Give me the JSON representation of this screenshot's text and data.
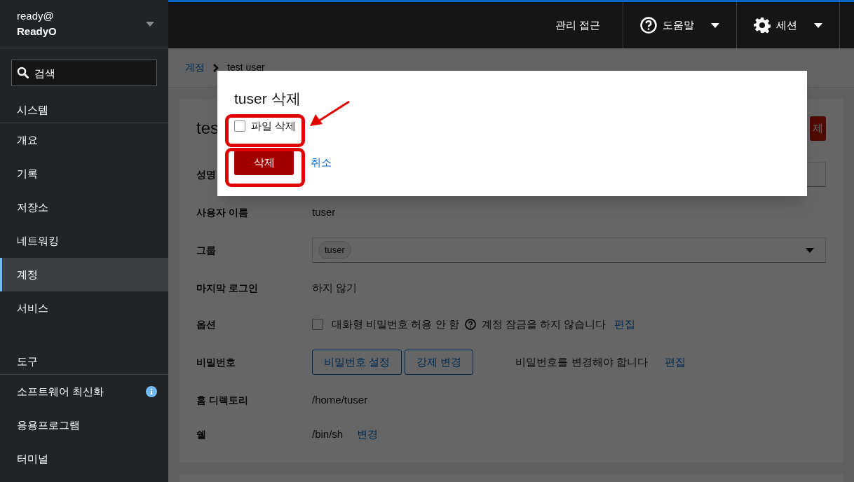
{
  "sidebar": {
    "host": {
      "user": "ready@",
      "name": "ReadyO"
    },
    "search": {
      "placeholder": "검색"
    },
    "sections": [
      {
        "title": "시스템",
        "items": [
          {
            "label": "개요",
            "selected": false
          },
          {
            "label": "기록",
            "selected": false
          },
          {
            "label": "저장소",
            "selected": false
          },
          {
            "label": "네트워킹",
            "selected": false
          },
          {
            "label": "계정",
            "selected": true
          },
          {
            "label": "서비스",
            "selected": false
          }
        ]
      },
      {
        "title": "도구",
        "items": [
          {
            "label": "소프트웨어 최신화",
            "selected": false,
            "info": true
          },
          {
            "label": "응용프로그램",
            "selected": false
          },
          {
            "label": "터미널",
            "selected": false
          }
        ]
      }
    ]
  },
  "topbar": {
    "admin": "관리 접근",
    "help": "도움말",
    "session": "세션"
  },
  "breadcrumb": {
    "parent": "계정",
    "current": "test user"
  },
  "account": {
    "title": "tes",
    "delete_button": "제",
    "rows": [
      {
        "kind": "field",
        "label": "성명"
      },
      {
        "kind": "text",
        "label": "사용자 이름",
        "value": "tuser"
      },
      {
        "kind": "select",
        "label": "그룹",
        "chip": "tuser"
      },
      {
        "kind": "text",
        "label": "마지막 로그인",
        "value": "하지 않기"
      },
      {
        "kind": "options",
        "label": "옵션",
        "checkbox": "대화형 비밀번호 허용 안 함",
        "checked": false,
        "note": "계정 잠금을 하지 않습니다",
        "link": "편집"
      },
      {
        "kind": "password",
        "label": "비밀번호",
        "buttons": [
          "비밀번호 설정",
          "강제 변경"
        ],
        "note": "비밀번호를 변경해야 합니다",
        "link": "편집"
      },
      {
        "kind": "text",
        "label": "홈 디렉토리",
        "value": "/home/tuser"
      },
      {
        "kind": "shell",
        "label": "쉘",
        "value": "/bin/sh",
        "link": "변경"
      }
    ]
  },
  "dialog": {
    "title": "tuser 삭제",
    "checkbox": {
      "label": "파일 삭제",
      "checked": false,
      "highlight": true,
      "arrow": true
    },
    "confirm": {
      "label": "삭제",
      "highlight": true
    },
    "cancel": "취소"
  }
}
